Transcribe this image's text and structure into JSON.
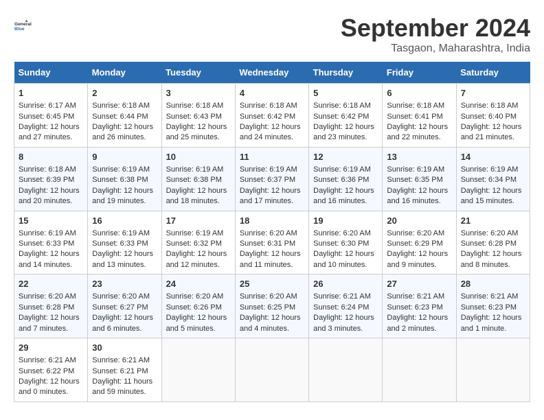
{
  "header": {
    "logo_line1": "General",
    "logo_line2": "Blue",
    "month": "September 2024",
    "location": "Tasgaon, Maharashtra, India"
  },
  "weekdays": [
    "Sunday",
    "Monday",
    "Tuesday",
    "Wednesday",
    "Thursday",
    "Friday",
    "Saturday"
  ],
  "weeks": [
    [
      {
        "day": "1",
        "lines": [
          "Sunrise: 6:17 AM",
          "Sunset: 6:45 PM",
          "Daylight: 12 hours",
          "and 27 minutes."
        ]
      },
      {
        "day": "2",
        "lines": [
          "Sunrise: 6:18 AM",
          "Sunset: 6:44 PM",
          "Daylight: 12 hours",
          "and 26 minutes."
        ]
      },
      {
        "day": "3",
        "lines": [
          "Sunrise: 6:18 AM",
          "Sunset: 6:43 PM",
          "Daylight: 12 hours",
          "and 25 minutes."
        ]
      },
      {
        "day": "4",
        "lines": [
          "Sunrise: 6:18 AM",
          "Sunset: 6:42 PM",
          "Daylight: 12 hours",
          "and 24 minutes."
        ]
      },
      {
        "day": "5",
        "lines": [
          "Sunrise: 6:18 AM",
          "Sunset: 6:42 PM",
          "Daylight: 12 hours",
          "and 23 minutes."
        ]
      },
      {
        "day": "6",
        "lines": [
          "Sunrise: 6:18 AM",
          "Sunset: 6:41 PM",
          "Daylight: 12 hours",
          "and 22 minutes."
        ]
      },
      {
        "day": "7",
        "lines": [
          "Sunrise: 6:18 AM",
          "Sunset: 6:40 PM",
          "Daylight: 12 hours",
          "and 21 minutes."
        ]
      }
    ],
    [
      {
        "day": "8",
        "lines": [
          "Sunrise: 6:18 AM",
          "Sunset: 6:39 PM",
          "Daylight: 12 hours",
          "and 20 minutes."
        ]
      },
      {
        "day": "9",
        "lines": [
          "Sunrise: 6:19 AM",
          "Sunset: 6:38 PM",
          "Daylight: 12 hours",
          "and 19 minutes."
        ]
      },
      {
        "day": "10",
        "lines": [
          "Sunrise: 6:19 AM",
          "Sunset: 6:38 PM",
          "Daylight: 12 hours",
          "and 18 minutes."
        ]
      },
      {
        "day": "11",
        "lines": [
          "Sunrise: 6:19 AM",
          "Sunset: 6:37 PM",
          "Daylight: 12 hours",
          "and 17 minutes."
        ]
      },
      {
        "day": "12",
        "lines": [
          "Sunrise: 6:19 AM",
          "Sunset: 6:36 PM",
          "Daylight: 12 hours",
          "and 16 minutes."
        ]
      },
      {
        "day": "13",
        "lines": [
          "Sunrise: 6:19 AM",
          "Sunset: 6:35 PM",
          "Daylight: 12 hours",
          "and 16 minutes."
        ]
      },
      {
        "day": "14",
        "lines": [
          "Sunrise: 6:19 AM",
          "Sunset: 6:34 PM",
          "Daylight: 12 hours",
          "and 15 minutes."
        ]
      }
    ],
    [
      {
        "day": "15",
        "lines": [
          "Sunrise: 6:19 AM",
          "Sunset: 6:33 PM",
          "Daylight: 12 hours",
          "and 14 minutes."
        ]
      },
      {
        "day": "16",
        "lines": [
          "Sunrise: 6:19 AM",
          "Sunset: 6:33 PM",
          "Daylight: 12 hours",
          "and 13 minutes."
        ]
      },
      {
        "day": "17",
        "lines": [
          "Sunrise: 6:19 AM",
          "Sunset: 6:32 PM",
          "Daylight: 12 hours",
          "and 12 minutes."
        ]
      },
      {
        "day": "18",
        "lines": [
          "Sunrise: 6:20 AM",
          "Sunset: 6:31 PM",
          "Daylight: 12 hours",
          "and 11 minutes."
        ]
      },
      {
        "day": "19",
        "lines": [
          "Sunrise: 6:20 AM",
          "Sunset: 6:30 PM",
          "Daylight: 12 hours",
          "and 10 minutes."
        ]
      },
      {
        "day": "20",
        "lines": [
          "Sunrise: 6:20 AM",
          "Sunset: 6:29 PM",
          "Daylight: 12 hours",
          "and 9 minutes."
        ]
      },
      {
        "day": "21",
        "lines": [
          "Sunrise: 6:20 AM",
          "Sunset: 6:28 PM",
          "Daylight: 12 hours",
          "and 8 minutes."
        ]
      }
    ],
    [
      {
        "day": "22",
        "lines": [
          "Sunrise: 6:20 AM",
          "Sunset: 6:28 PM",
          "Daylight: 12 hours",
          "and 7 minutes."
        ]
      },
      {
        "day": "23",
        "lines": [
          "Sunrise: 6:20 AM",
          "Sunset: 6:27 PM",
          "Daylight: 12 hours",
          "and 6 minutes."
        ]
      },
      {
        "day": "24",
        "lines": [
          "Sunrise: 6:20 AM",
          "Sunset: 6:26 PM",
          "Daylight: 12 hours",
          "and 5 minutes."
        ]
      },
      {
        "day": "25",
        "lines": [
          "Sunrise: 6:20 AM",
          "Sunset: 6:25 PM",
          "Daylight: 12 hours",
          "and 4 minutes."
        ]
      },
      {
        "day": "26",
        "lines": [
          "Sunrise: 6:21 AM",
          "Sunset: 6:24 PM",
          "Daylight: 12 hours",
          "and 3 minutes."
        ]
      },
      {
        "day": "27",
        "lines": [
          "Sunrise: 6:21 AM",
          "Sunset: 6:23 PM",
          "Daylight: 12 hours",
          "and 2 minutes."
        ]
      },
      {
        "day": "28",
        "lines": [
          "Sunrise: 6:21 AM",
          "Sunset: 6:23 PM",
          "Daylight: 12 hours",
          "and 1 minute."
        ]
      }
    ],
    [
      {
        "day": "29",
        "lines": [
          "Sunrise: 6:21 AM",
          "Sunset: 6:22 PM",
          "Daylight: 12 hours",
          "and 0 minutes."
        ]
      },
      {
        "day": "30",
        "lines": [
          "Sunrise: 6:21 AM",
          "Sunset: 6:21 PM",
          "Daylight: 11 hours",
          "and 59 minutes."
        ]
      },
      {
        "day": "",
        "lines": []
      },
      {
        "day": "",
        "lines": []
      },
      {
        "day": "",
        "lines": []
      },
      {
        "day": "",
        "lines": []
      },
      {
        "day": "",
        "lines": []
      }
    ]
  ]
}
